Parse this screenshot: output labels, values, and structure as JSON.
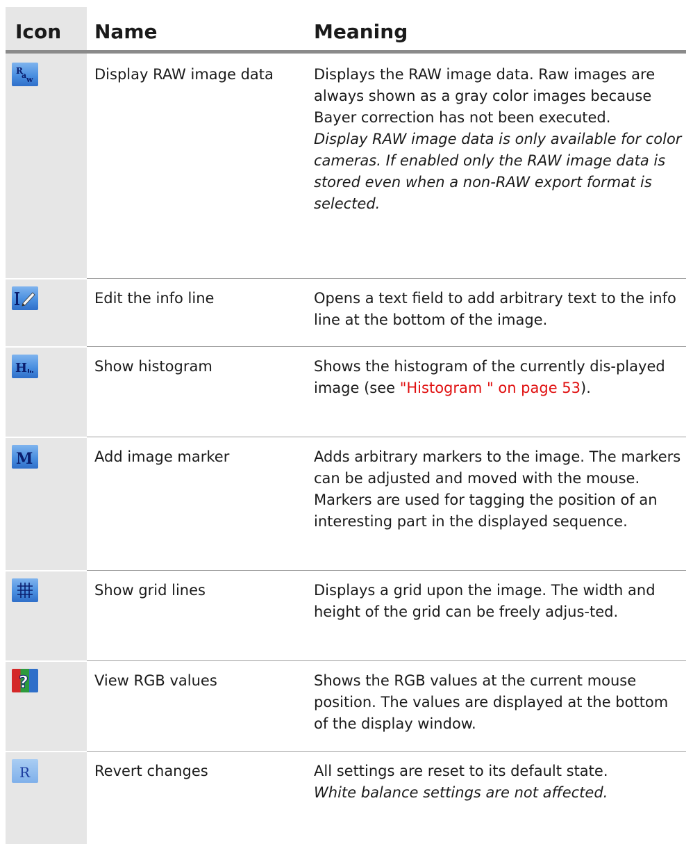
{
  "table": {
    "headers": {
      "icon": "Icon",
      "name": "Name",
      "meaning": "Meaning"
    },
    "rows": [
      {
        "icon": "raw-image-icon",
        "name": "Display RAW image data",
        "meaning": "Displays the RAW image data. Raw images are always shown as a gray color images because Bayer correction has not been executed.",
        "note": "Display RAW image data is only available for color cameras. If enabled only the RAW image data is stored even when a non-RAW export format is selected."
      },
      {
        "icon": "edit-info-line-icon",
        "name": "Edit the info line",
        "meaning": "Opens a text field to add arbitrary text to the info line at the bottom of the image."
      },
      {
        "icon": "histogram-icon",
        "name": "Show histogram",
        "meaning_pre": "Shows the histogram of the currently dis-played image (see ",
        "meaning_link": "\"Histogram \" on page 53",
        "meaning_post": ")."
      },
      {
        "icon": "image-marker-icon",
        "name": "Add image marker",
        "meaning": "Adds arbitrary markers to the image. The markers can be adjusted and moved with the mouse. Markers are used for tagging the position of an interesting part in the displayed sequence."
      },
      {
        "icon": "grid-lines-icon",
        "name": "Show grid lines",
        "meaning": "Displays a grid upon the image. The width and height of the grid can be freely adjus-ted."
      },
      {
        "icon": "rgb-values-icon",
        "name": "View RGB values",
        "meaning": "Shows the RGB values at the current mouse position. The values are displayed at the bottom of the display window."
      },
      {
        "icon": "revert-icon",
        "name": "Revert changes",
        "meaning": "All settings are reset to its default state.",
        "note": "White balance settings are not affected."
      }
    ]
  },
  "colors": {
    "link": "#e01010",
    "icon_column_bg": "#e6e6e6",
    "header_rule": "#8a8a8a",
    "row_rule": "#9c9c9c",
    "icon_blue": "#4a8fe0"
  }
}
